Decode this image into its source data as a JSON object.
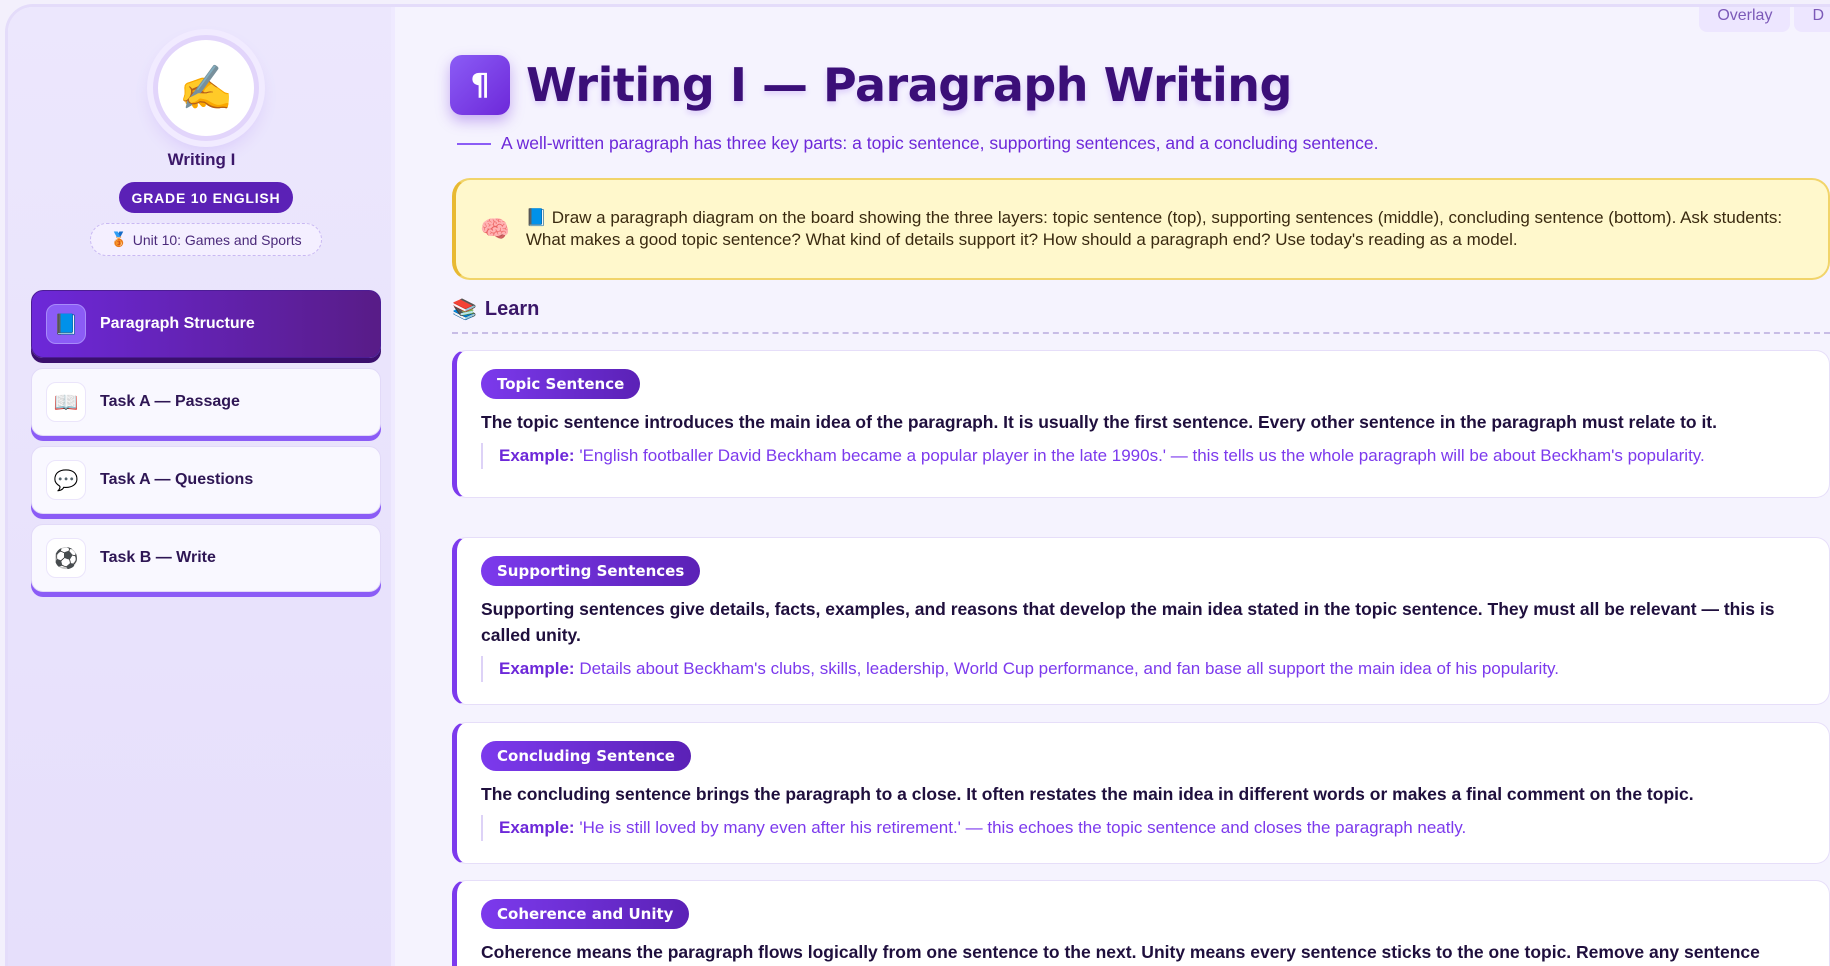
{
  "sidebar": {
    "avatar_emoji": "✍️",
    "app_name": "Writing I",
    "grade": "GRADE 10 ENGLISH",
    "unit_icon": "🥉",
    "unit": "Unit 10: Games and Sports",
    "items": [
      {
        "icon": "📘",
        "label": "Paragraph Structure",
        "active": true
      },
      {
        "icon": "📖",
        "label": "Task A — Passage",
        "active": false
      },
      {
        "icon": "💬",
        "label": "Task A — Questions",
        "active": false
      },
      {
        "icon": "⚽",
        "label": "Task B — Write",
        "active": false
      }
    ]
  },
  "topbar": {
    "overlay": "Overlay",
    "second": "D"
  },
  "header": {
    "icon": "¶",
    "title": "Writing I — Paragraph Writing",
    "subtitle": "A well-written paragraph has three key parts: a topic sentence, supporting sentences, and a concluding sentence."
  },
  "teacher_note": {
    "icon": "🧠",
    "text": "📘 Draw a paragraph diagram on the board showing the three layers: topic sentence (top), supporting sentences (middle), concluding sentence (bottom). Ask students: What makes a good topic sentence? What kind of details support it? How should a paragraph end? Use today's reading as a model."
  },
  "learn": {
    "icon": "📚",
    "heading": "Learn",
    "cards": [
      {
        "tag": "Topic Sentence",
        "body": "The topic sentence introduces the main idea of the paragraph. It is usually the first sentence. Every other sentence in the paragraph must relate to it.",
        "example_label": "Example:",
        "example": "'English footballer David Beckham became a popular player in the late 1990s.' — this tells us the whole paragraph will be about Beckham's popularity."
      },
      {
        "tag": "Supporting Sentences",
        "body": "Supporting sentences give details, facts, examples, and reasons that develop the main idea stated in the topic sentence. They must all be relevant — this is called unity.",
        "example_label": "Example:",
        "example": "Details about Beckham's clubs, skills, leadership, World Cup performance, and fan base all support the main idea of his popularity."
      },
      {
        "tag": "Concluding Sentence",
        "body": "The concluding sentence brings the paragraph to a close. It often restates the main idea in different words or makes a final comment on the topic.",
        "example_label": "Example:",
        "example": "'He is still loved by many even after his retirement.' — this echoes the topic sentence and closes the paragraph neatly."
      },
      {
        "tag": "Coherence and Unity",
        "body": "Coherence means the paragraph flows logically from one sentence to the next. Unity means every sentence sticks to the one topic. Remove any sentence"
      }
    ]
  }
}
